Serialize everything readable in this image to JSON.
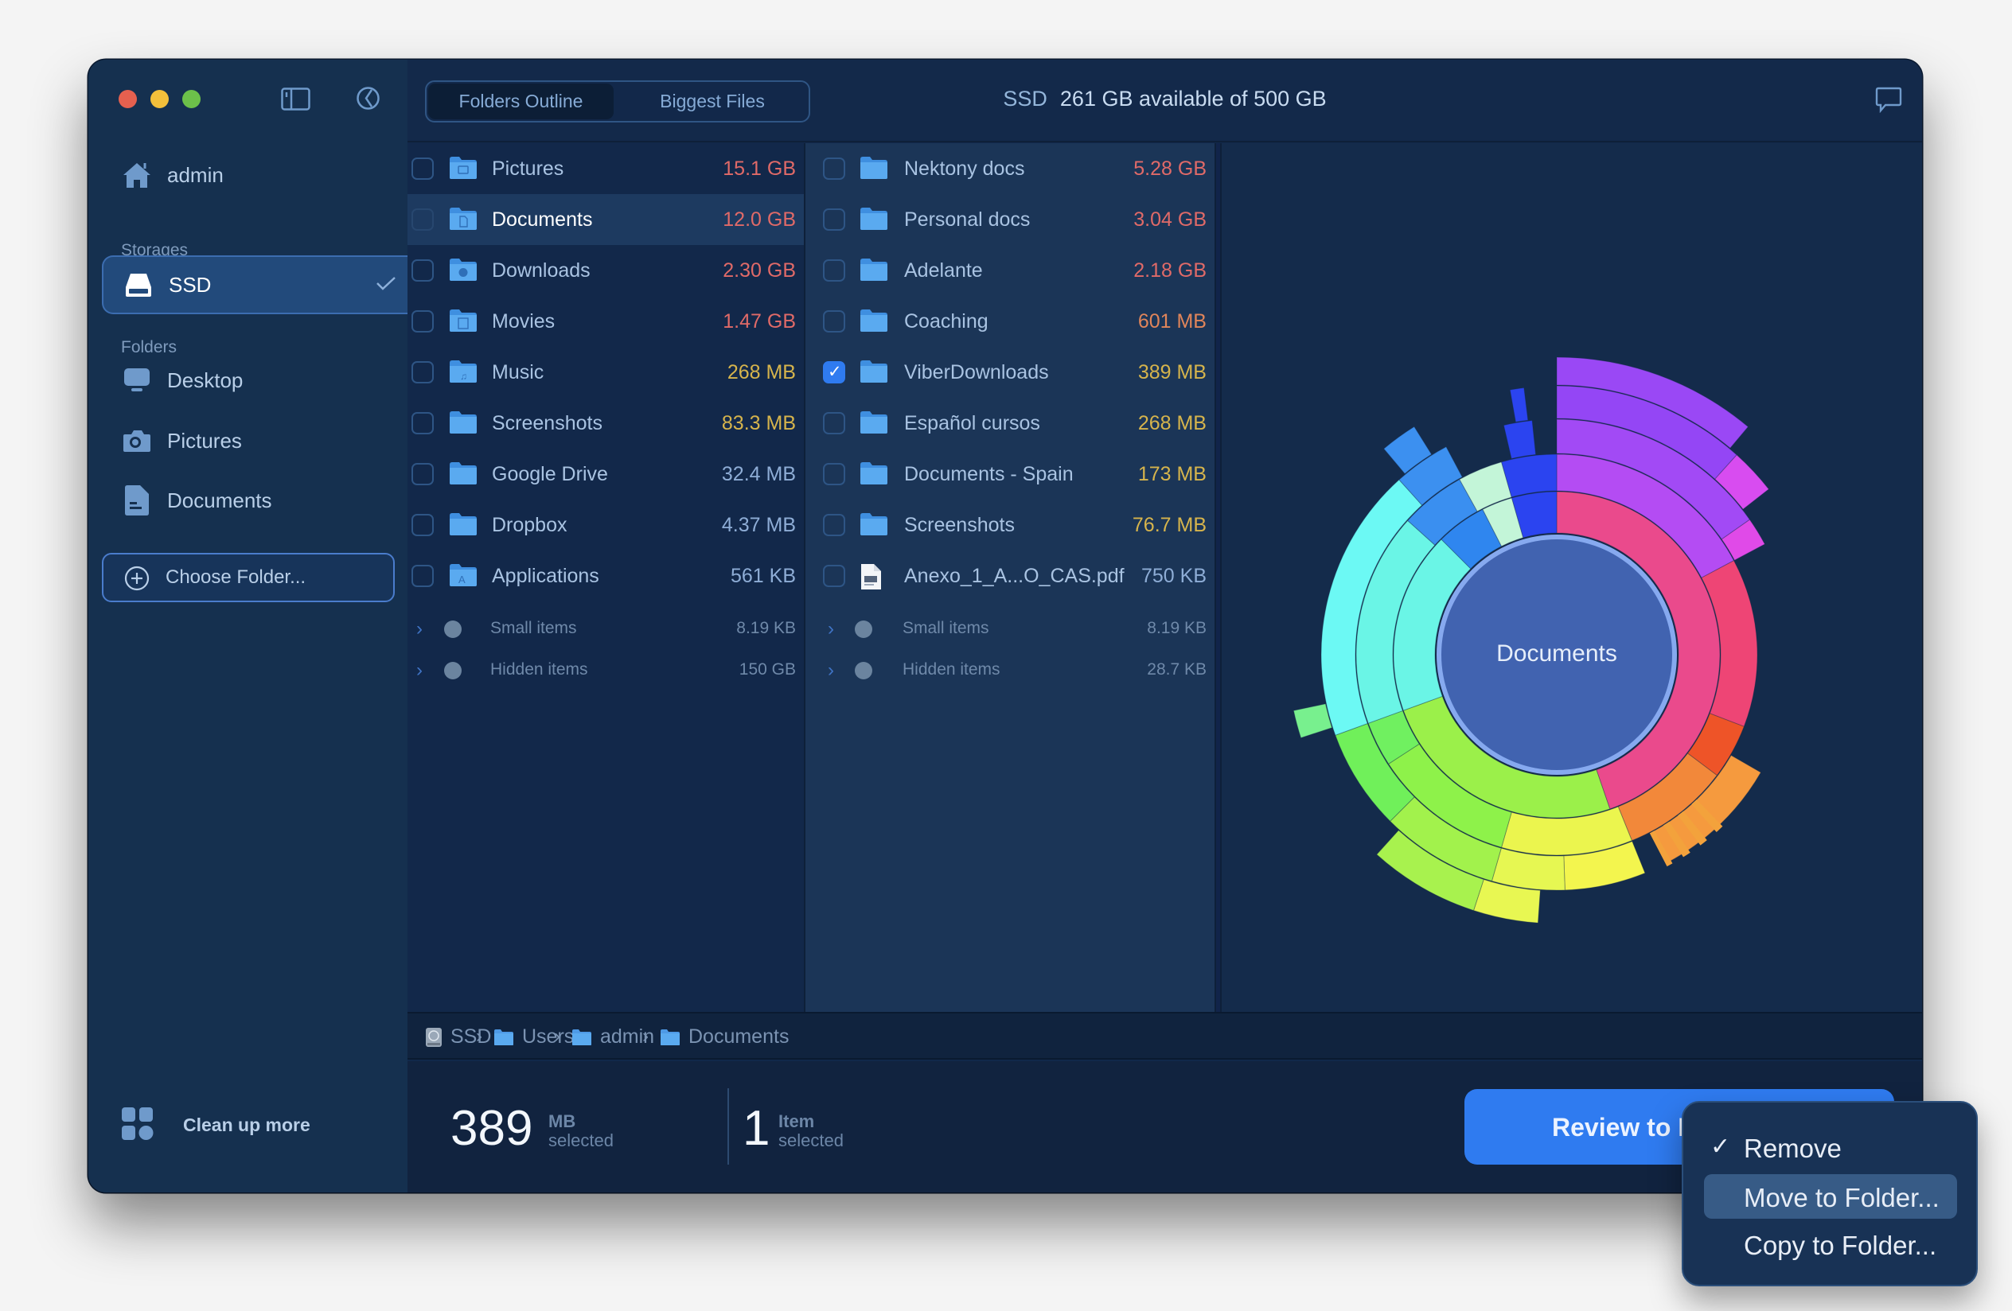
{
  "window": {
    "traffic_lights": [
      "close",
      "minimize",
      "zoom"
    ],
    "toolbar_icons": [
      "sidebar-toggle-icon",
      "history-icon"
    ]
  },
  "sidebar": {
    "home_label": "admin",
    "storages_title": "Storages",
    "storages": [
      {
        "label": "SSD",
        "icon": "disk-icon",
        "selected": true
      }
    ],
    "folders_title": "Folders",
    "folders": [
      {
        "label": "Desktop",
        "icon": "desktop-icon"
      },
      {
        "label": "Pictures",
        "icon": "camera-icon"
      },
      {
        "label": "Documents",
        "icon": "document-icon"
      }
    ],
    "choose_folder_label": "Choose Folder...",
    "cleanup_label": "Clean up more"
  },
  "header": {
    "tabs": [
      {
        "label": "Folders Outline",
        "active": true
      },
      {
        "label": "Biggest Files",
        "active": false
      }
    ],
    "disk_name": "SSD",
    "disk_status": "261 GB available of 500 GB",
    "icons": [
      "feedback-icon",
      "help-icon"
    ]
  },
  "colors": {
    "accent": "#2f7bf0",
    "size_gb": "#e06a68",
    "size_large_mb": "#e0855a",
    "size_mb": "#d6b44c",
    "size_small": "#8eadd6",
    "muted": "#6f89a9"
  },
  "column1": {
    "rows": [
      {
        "name": "Pictures",
        "size": "15.1 GB",
        "tone": "size_gb",
        "checked": false,
        "selected": false
      },
      {
        "name": "Documents",
        "size": "12.0 GB",
        "tone": "size_gb",
        "checked": false,
        "selected": true
      },
      {
        "name": "Downloads",
        "size": "2.30 GB",
        "tone": "size_gb",
        "checked": false,
        "selected": false
      },
      {
        "name": "Movies",
        "size": "1.47 GB",
        "tone": "size_gb",
        "checked": false,
        "selected": false
      },
      {
        "name": "Music",
        "size": "268 MB",
        "tone": "size_mb",
        "checked": false,
        "selected": false
      },
      {
        "name": "Screenshots",
        "size": "83.3 MB",
        "tone": "size_mb",
        "checked": false,
        "selected": false
      },
      {
        "name": "Google Drive",
        "size": "32.4 MB",
        "tone": "size_small",
        "checked": false,
        "selected": false
      },
      {
        "name": "Dropbox",
        "size": "4.37 MB",
        "tone": "size_small",
        "checked": false,
        "selected": false
      },
      {
        "name": "Applications",
        "size": "561 KB",
        "tone": "size_small",
        "checked": false,
        "selected": false
      }
    ],
    "meta": [
      {
        "name": "Small items",
        "size": "8.19 KB"
      },
      {
        "name": "Hidden items",
        "size": "150 GB"
      }
    ]
  },
  "column2": {
    "rows": [
      {
        "name": "Nektony docs",
        "size": "5.28 GB",
        "tone": "size_gb",
        "checked": false,
        "type": "folder"
      },
      {
        "name": "Personal docs",
        "size": "3.04 GB",
        "tone": "size_gb",
        "checked": false,
        "type": "folder"
      },
      {
        "name": "Adelante",
        "size": "2.18 GB",
        "tone": "size_gb",
        "checked": false,
        "type": "folder"
      },
      {
        "name": "Coaching",
        "size": "601 MB",
        "tone": "size_large_mb",
        "checked": false,
        "type": "folder"
      },
      {
        "name": "ViberDownloads",
        "size": "389 MB",
        "tone": "size_mb",
        "checked": true,
        "type": "folder"
      },
      {
        "name": "Español cursos",
        "size": "268 MB",
        "tone": "size_mb",
        "checked": false,
        "type": "folder"
      },
      {
        "name": "Documents - Spain",
        "size": "173 MB",
        "tone": "size_mb",
        "checked": false,
        "type": "folder"
      },
      {
        "name": "Screenshots",
        "size": "76.7 MB",
        "tone": "size_mb",
        "checked": false,
        "type": "folder"
      },
      {
        "name": "Anexo_1_A...O_CAS.pdf",
        "size": "750 KB",
        "tone": "size_small",
        "checked": false,
        "type": "pdf"
      }
    ],
    "meta": [
      {
        "name": "Small items",
        "size": "8.19 KB"
      },
      {
        "name": "Hidden items",
        "size": "28.7 KB"
      }
    ]
  },
  "breadcrumb": [
    {
      "label": "SSD",
      "icon": "hard-drive-icon"
    },
    {
      "label": "Users",
      "icon": "users-folder-icon"
    },
    {
      "label": "admin",
      "icon": "home-folder-icon"
    },
    {
      "label": "Documents",
      "icon": "documents-folder-icon"
    }
  ],
  "footer": {
    "selected_size": "389",
    "selected_size_unit": "MB",
    "selected_size_caption": "selected",
    "selected_count": "1",
    "selected_count_unit": "Item",
    "selected_count_caption": "selected",
    "review_button_label": "Review to Remove"
  },
  "action_menu": {
    "items": [
      {
        "label": "Remove",
        "checked": true,
        "highlighted": false
      },
      {
        "label": "Move to Folder...",
        "checked": false,
        "highlighted": true
      },
      {
        "label": "Copy to Folder...",
        "checked": false,
        "highlighted": false
      }
    ],
    "check_glyph": "✓"
  },
  "chart_data": {
    "type": "sunburst",
    "title": "Documents",
    "center_label": "Documents",
    "angle_units": "degrees clockwise from top (share of parent folder size)",
    "segments": [
      {
        "depth": 1,
        "start": 0,
        "end": 161,
        "color": "#ea4a8c"
      },
      {
        "depth": 1,
        "start": 161,
        "end": 250,
        "color": "#9bf04a"
      },
      {
        "depth": 1,
        "start": 250,
        "end": 315,
        "color": "#6af5e6"
      },
      {
        "depth": 1,
        "start": 315,
        "end": 333,
        "color": "#2f86ef"
      },
      {
        "depth": 1,
        "start": 333,
        "end": 344,
        "color": "#c3f5d8"
      },
      {
        "depth": 1,
        "start": 344,
        "end": 360,
        "color": "#2b44f0"
      },
      {
        "depth": 2,
        "start": 0,
        "end": 62,
        "color": "#b44cf3"
      },
      {
        "depth": 2,
        "start": 62,
        "end": 111,
        "color": "#ee4575"
      },
      {
        "depth": 2,
        "start": 111,
        "end": 127,
        "color": "#ee5428"
      },
      {
        "depth": 2,
        "start": 127,
        "end": 158,
        "color": "#f2883a"
      },
      {
        "depth": 2,
        "start": 158,
        "end": 196,
        "color": "#ebf54e"
      },
      {
        "depth": 2,
        "start": 196,
        "end": 237,
        "color": "#8ef24a"
      },
      {
        "depth": 2,
        "start": 237,
        "end": 250,
        "color": "#70f060"
      },
      {
        "depth": 2,
        "start": 250,
        "end": 312,
        "color": "#6af5e6"
      },
      {
        "depth": 2,
        "start": 312,
        "end": 331,
        "color": "#3a8ff0"
      },
      {
        "depth": 2,
        "start": 331,
        "end": 344,
        "color": "#c3f5d8"
      },
      {
        "depth": 2,
        "start": 344,
        "end": 360,
        "color": "#2b44f0"
      },
      {
        "depth": 3,
        "start": 0,
        "end": 55,
        "color": "#a24af5"
      },
      {
        "depth": 3,
        "start": 55,
        "end": 62,
        "color": "#e04ae8"
      },
      {
        "depth": 3,
        "start": 120,
        "end": 152,
        "color": "#f59a3e"
      },
      {
        "depth": 3,
        "start": 158,
        "end": 178,
        "color": "#f3f54e"
      },
      {
        "depth": 3,
        "start": 178,
        "end": 196,
        "color": "#e6f752"
      },
      {
        "depth": 3,
        "start": 196,
        "end": 225,
        "color": "#a2f24c"
      },
      {
        "depth": 3,
        "start": 225,
        "end": 250,
        "color": "#70f05a"
      },
      {
        "depth": 3,
        "start": 250,
        "end": 318,
        "color": "#6cf9f4"
      },
      {
        "depth": 3,
        "start": 318,
        "end": 332,
        "color": "#3c90f0"
      },
      {
        "depth": 3,
        "start": 347,
        "end": 354,
        "color": "#2b44f0"
      },
      {
        "depth": 4,
        "start": 0,
        "end": 42,
        "color": "#9446f5"
      },
      {
        "depth": 4,
        "start": 42,
        "end": 52,
        "color": "#d84cf0"
      },
      {
        "depth": 4,
        "start": 184,
        "end": 198,
        "color": "#e8f752"
      },
      {
        "depth": 4,
        "start": 198,
        "end": 222,
        "color": "#a8f24e"
      },
      {
        "depth": 4,
        "start": 252,
        "end": 258,
        "color": "#78f08e"
      },
      {
        "depth": 4,
        "start": 320,
        "end": 328,
        "color": "#3c90f0"
      },
      {
        "depth": 4,
        "start": 350,
        "end": 353,
        "color": "#2b44f0"
      },
      {
        "depth": 5,
        "start": 0,
        "end": 40,
        "color": "#9a48f5"
      }
    ]
  }
}
